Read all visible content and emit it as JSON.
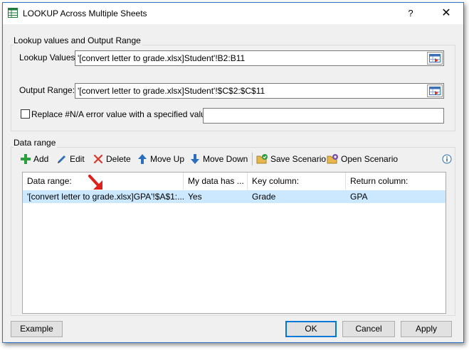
{
  "window": {
    "title": "LOOKUP Across Multiple Sheets",
    "help_label": "?",
    "close_label": "✕"
  },
  "lookup_group": {
    "label": "Lookup values and Output Range",
    "lookup_values_label": "Lookup Values:",
    "lookup_values_value": "'[convert letter to grade.xlsx]Student'!B2:B11",
    "output_range_label": "Output Range:",
    "output_range_value": "'[convert letter to grade.xlsx]Student'!$C$2:$C$11",
    "replace_label": "Replace #N/A error value with a specified value:",
    "replace_checked": false,
    "replace_value": ""
  },
  "data_range_group": {
    "label": "Data range",
    "toolbar": {
      "add": "Add",
      "edit": "Edit",
      "delete": "Delete",
      "move_up": "Move Up",
      "move_down": "Move Down",
      "save_scenario": "Save Scenario",
      "open_scenario": "Open Scenario"
    },
    "columns": [
      "Data range:",
      "My data has ...",
      "Key column:",
      "Return column:"
    ],
    "rows": [
      [
        "'[convert letter to grade.xlsx]GPA'!$A$1:...",
        "Yes",
        "Grade",
        "GPA"
      ]
    ]
  },
  "footer": {
    "example": "Example",
    "ok": "OK",
    "cancel": "Cancel",
    "apply": "Apply"
  },
  "colors": {
    "accent": "#0078d7",
    "selection": "#cce8ff",
    "add_green": "#2e9d3e",
    "delete_red": "#d9372b",
    "arrow_blue": "#2a6ebd"
  }
}
